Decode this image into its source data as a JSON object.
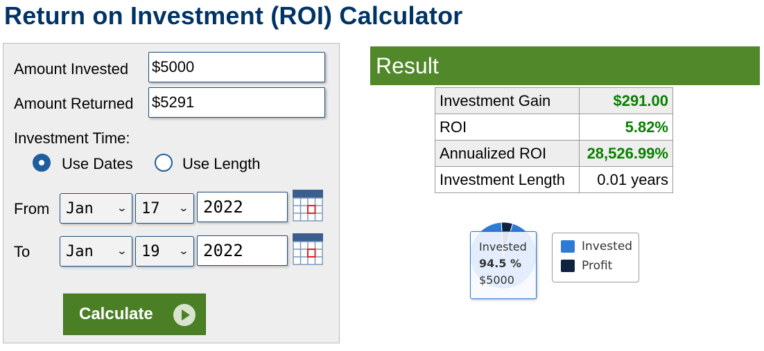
{
  "page": {
    "title": "Return on Investment (ROI) Calculator"
  },
  "form": {
    "amount_invested_label": "Amount Invested",
    "amount_invested_value": "$5000",
    "amount_returned_label": "Amount Returned",
    "amount_returned_value": "$5291",
    "investment_time_label": "Investment Time:",
    "use_dates_label": "Use Dates",
    "use_dates_selected": true,
    "use_length_label": "Use Length",
    "from_label": "From",
    "from_month": "Jan",
    "from_day": "17",
    "from_year": "2022",
    "to_label": "To",
    "to_month": "Jan",
    "to_day": "19",
    "to_year": "2022",
    "calculate_label": "Calculate"
  },
  "result": {
    "title": "Result",
    "rows": [
      {
        "label": "Investment Gain",
        "value": "$291.00"
      },
      {
        "label": "ROI",
        "value": "5.82%"
      },
      {
        "label": "Annualized ROI",
        "value": "28,526.99%"
      },
      {
        "label": "Investment Length",
        "value": "0.01 years"
      }
    ]
  },
  "chart_data": {
    "type": "pie",
    "categories": [
      "Invested",
      "Profit"
    ],
    "values": [
      94.5,
      5.5
    ],
    "colors": [
      "#2e7bd6",
      "#0d2340"
    ],
    "legend": "right",
    "tooltip": {
      "label": "Invested",
      "percent": "94.5 %",
      "value": "$5000"
    }
  },
  "colors": {
    "title": "#003366",
    "accent_green": "#51882a",
    "value_green": "#078000"
  }
}
